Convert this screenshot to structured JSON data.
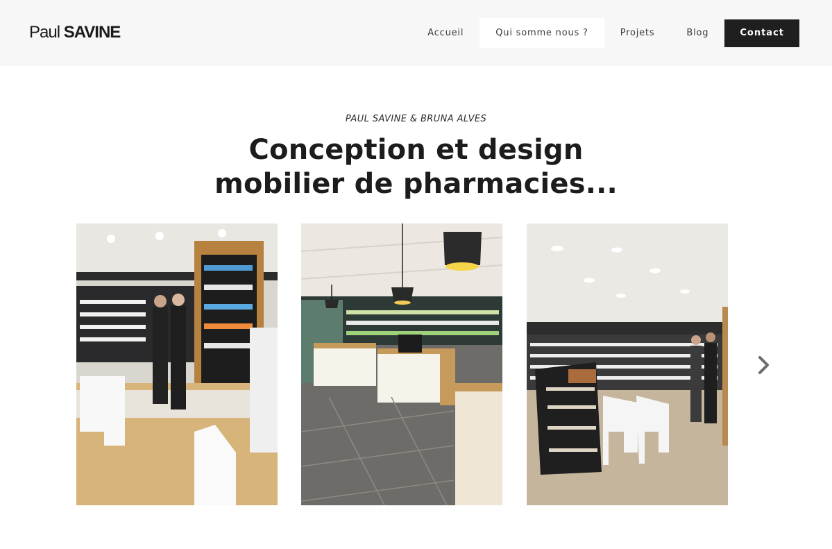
{
  "brand": {
    "first": "Paul",
    "last": "SAVINE"
  },
  "nav": {
    "items": [
      {
        "label": "Accueil"
      },
      {
        "label": "Qui somme nous ?"
      },
      {
        "label": "Projets"
      },
      {
        "label": "Blog"
      }
    ],
    "active_index": 1,
    "contact_label": "Contact"
  },
  "hero": {
    "eyebrow": "PAUL SAVINE & BRUNA ALVES",
    "headline_line1": "Conception et design",
    "headline_line2": "mobilier de pharmacies..."
  },
  "gallery": {
    "images": [
      {
        "name": "pharmacy-interior-wood-floor"
      },
      {
        "name": "pharmacy-counters-tiled-floor"
      },
      {
        "name": "pharmacy-display-shelves"
      }
    ],
    "next_icon": "chevron-right-icon"
  },
  "colors": {
    "header_bg": "#f7f7f7",
    "contact_bg": "#1f1f1f",
    "text": "#1f1f1f"
  }
}
